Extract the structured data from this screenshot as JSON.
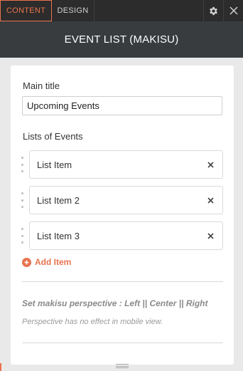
{
  "tabs": {
    "content": "CONTENT",
    "design": "DESIGN"
  },
  "header": {
    "title": "EVENT LIST (MAKISU)"
  },
  "form": {
    "main_title_label": "Main title",
    "main_title_value": "Upcoming Events",
    "events_label": "Lists of Events",
    "items": [
      {
        "label": "List Item"
      },
      {
        "label": "List Item 2"
      },
      {
        "label": "List Item 3"
      }
    ],
    "add_item_label": "Add Item",
    "perspective_label": "Set makisu perspective : Left || Center || Right",
    "perspective_note": "Perspective has no effect in mobile view."
  },
  "colors": {
    "accent": "#e8734d",
    "topbar": "#2c2c2c",
    "header": "#383c3f",
    "background": "#e9e9e9"
  },
  "icons": {
    "settings": "gear-icon",
    "close": "close-icon",
    "remove": "x-icon",
    "add": "plus-circle-icon",
    "drag": "drag-handle-icon"
  }
}
